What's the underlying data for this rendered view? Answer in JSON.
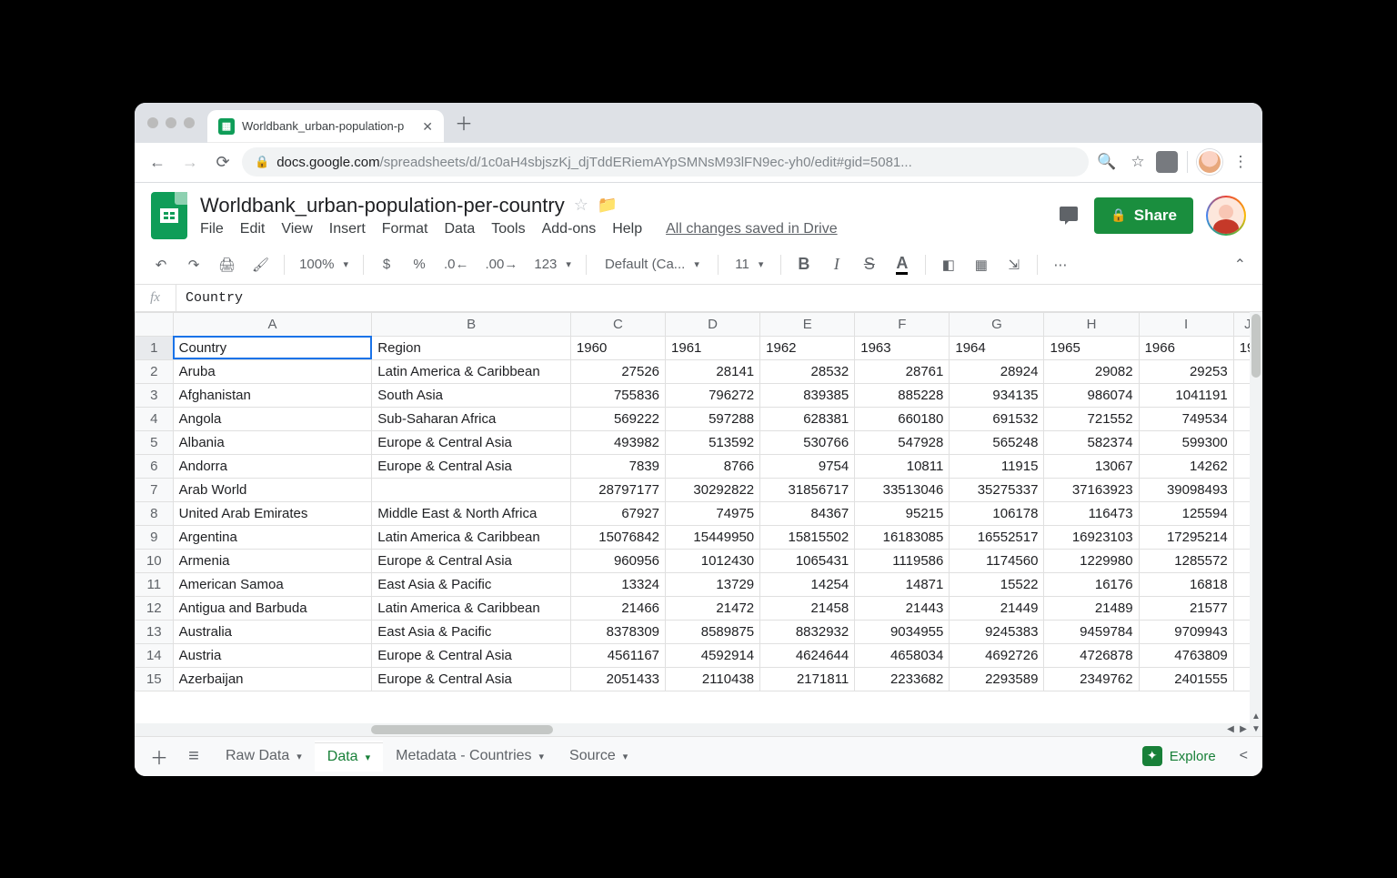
{
  "browser": {
    "tab_title": "Worldbank_urban-population-p",
    "url_host": "docs.google.com",
    "url_path": "/spreadsheets/d/1c0aH4sbjszKj_djTddERiemAYpSMNsM93lFN9ec-yh0/edit#gid=5081..."
  },
  "doc": {
    "title": "Worldbank_urban-population-per-country",
    "menus": [
      "File",
      "Edit",
      "View",
      "Insert",
      "Format",
      "Data",
      "Tools",
      "Add-ons",
      "Help"
    ],
    "save_status": "All changes saved in Drive",
    "share_label": "Share"
  },
  "toolbar": {
    "zoom": "100%",
    "number_format": "123",
    "font": "Default (Ca...",
    "font_size": "11",
    "more": "⋯"
  },
  "fx": {
    "value": "Country"
  },
  "grid": {
    "col_headers": [
      "A",
      "B",
      "C",
      "D",
      "E",
      "F",
      "G",
      "H",
      "I",
      "J"
    ],
    "last_partial_header": "19",
    "rows": [
      {
        "n": 1,
        "c": [
          "Country",
          "Region",
          "1960",
          "1961",
          "1962",
          "1963",
          "1964",
          "1965",
          "1966",
          ""
        ],
        "header": true
      },
      {
        "n": 2,
        "c": [
          "Aruba",
          "Latin America & Caribbean",
          "27526",
          "28141",
          "28532",
          "28761",
          "28924",
          "29082",
          "29253",
          ""
        ]
      },
      {
        "n": 3,
        "c": [
          "Afghanistan",
          "South Asia",
          "755836",
          "796272",
          "839385",
          "885228",
          "934135",
          "986074",
          "1041191",
          ""
        ]
      },
      {
        "n": 4,
        "c": [
          "Angola",
          "Sub-Saharan Africa",
          "569222",
          "597288",
          "628381",
          "660180",
          "691532",
          "721552",
          "749534",
          ""
        ]
      },
      {
        "n": 5,
        "c": [
          "Albania",
          "Europe & Central Asia",
          "493982",
          "513592",
          "530766",
          "547928",
          "565248",
          "582374",
          "599300",
          ""
        ]
      },
      {
        "n": 6,
        "c": [
          "Andorra",
          "Europe & Central Asia",
          "7839",
          "8766",
          "9754",
          "10811",
          "11915",
          "13067",
          "14262",
          ""
        ]
      },
      {
        "n": 7,
        "c": [
          "Arab World",
          "",
          "28797177",
          "30292822",
          "31856717",
          "33513046",
          "35275337",
          "37163923",
          "39098493",
          ""
        ]
      },
      {
        "n": 8,
        "c": [
          "United Arab Emirates",
          "Middle East & North Africa",
          "67927",
          "74975",
          "84367",
          "95215",
          "106178",
          "116473",
          "125594",
          ""
        ]
      },
      {
        "n": 9,
        "c": [
          "Argentina",
          "Latin America & Caribbean",
          "15076842",
          "15449950",
          "15815502",
          "16183085",
          "16552517",
          "16923103",
          "17295214",
          ""
        ]
      },
      {
        "n": 10,
        "c": [
          "Armenia",
          "Europe & Central Asia",
          "960956",
          "1012430",
          "1065431",
          "1119586",
          "1174560",
          "1229980",
          "1285572",
          ""
        ]
      },
      {
        "n": 11,
        "c": [
          "American Samoa",
          "East Asia & Pacific",
          "13324",
          "13729",
          "14254",
          "14871",
          "15522",
          "16176",
          "16818",
          ""
        ]
      },
      {
        "n": 12,
        "c": [
          "Antigua and Barbuda",
          "Latin America & Caribbean",
          "21466",
          "21472",
          "21458",
          "21443",
          "21449",
          "21489",
          "21577",
          ""
        ]
      },
      {
        "n": 13,
        "c": [
          "Australia",
          "East Asia & Pacific",
          "8378309",
          "8589875",
          "8832932",
          "9034955",
          "9245383",
          "9459784",
          "9709943",
          ""
        ]
      },
      {
        "n": 14,
        "c": [
          "Austria",
          "Europe & Central Asia",
          "4561167",
          "4592914",
          "4624644",
          "4658034",
          "4692726",
          "4726878",
          "4763809",
          ""
        ]
      },
      {
        "n": 15,
        "c": [
          "Azerbaijan",
          "Europe & Central Asia",
          "2051433",
          "2110438",
          "2171811",
          "2233682",
          "2293589",
          "2349762",
          "2401555",
          ""
        ]
      }
    ]
  },
  "sheet_tabs": {
    "tabs": [
      "Raw Data",
      "Data",
      "Metadata - Countries",
      "Source"
    ],
    "active_index": 1,
    "explore_label": "Explore"
  }
}
